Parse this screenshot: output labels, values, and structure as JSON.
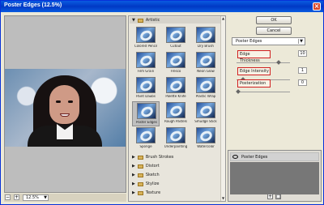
{
  "window": {
    "title": "Poster Edges (12.5%)",
    "close_label": "×"
  },
  "preview": {
    "zoom_minus": "−",
    "zoom_plus": "+",
    "zoom_level": "12.5%",
    "zoom_arrow": "▼"
  },
  "gallery": {
    "categories": [
      {
        "label": "Artistic",
        "expanded": true
      },
      {
        "label": "Brush Strokes",
        "expanded": false
      },
      {
        "label": "Distort",
        "expanded": false
      },
      {
        "label": "Sketch",
        "expanded": false
      },
      {
        "label": "Stylize",
        "expanded": false
      },
      {
        "label": "Texture",
        "expanded": false
      }
    ],
    "filters": [
      "Colored Pencil",
      "Cutout",
      "Dry Brush",
      "Film Grain",
      "Fresco",
      "Neon Glow",
      "Paint Daubs",
      "Palette Knife",
      "Plastic Wrap",
      "Poster Edges",
      "Rough Pastels",
      "Smudge Stick",
      "Sponge",
      "Underpainting",
      "Watercolor"
    ],
    "selected_filter": "Poster Edges",
    "expanded_icon": "▼",
    "collapsed_icon": "▶"
  },
  "controls": {
    "ok_label": "OK",
    "cancel_label": "Cancel",
    "filter_select": "Poster Edges",
    "dropdown_arrow": "▼",
    "params": [
      {
        "label": "Edge Thickness",
        "value": "10",
        "fraction": 0.8
      },
      {
        "label": "Edge Intensity",
        "value": "1",
        "fraction": 0.1
      },
      {
        "label": "Posterization",
        "value": "0",
        "fraction": 0.0
      }
    ]
  },
  "layers": {
    "visibility_icon": "eye-icon",
    "active_layer": "Poster Edges"
  }
}
